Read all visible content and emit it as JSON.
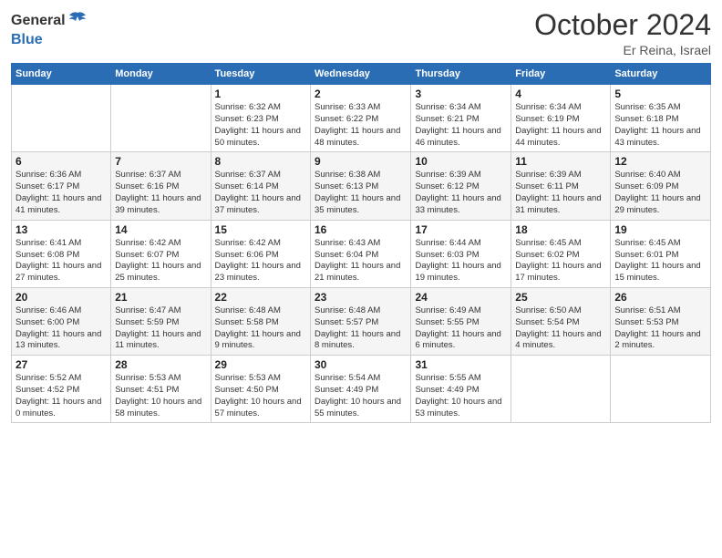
{
  "logo": {
    "general": "General",
    "blue": "Blue"
  },
  "header": {
    "month": "October 2024",
    "location": "Er Reina, Israel"
  },
  "weekdays": [
    "Sunday",
    "Monday",
    "Tuesday",
    "Wednesday",
    "Thursday",
    "Friday",
    "Saturday"
  ],
  "weeks": [
    [
      {
        "day": "",
        "sunrise": "",
        "sunset": "",
        "daylight": ""
      },
      {
        "day": "",
        "sunrise": "",
        "sunset": "",
        "daylight": ""
      },
      {
        "day": "1",
        "sunrise": "Sunrise: 6:32 AM",
        "sunset": "Sunset: 6:23 PM",
        "daylight": "Daylight: 11 hours and 50 minutes."
      },
      {
        "day": "2",
        "sunrise": "Sunrise: 6:33 AM",
        "sunset": "Sunset: 6:22 PM",
        "daylight": "Daylight: 11 hours and 48 minutes."
      },
      {
        "day": "3",
        "sunrise": "Sunrise: 6:34 AM",
        "sunset": "Sunset: 6:21 PM",
        "daylight": "Daylight: 11 hours and 46 minutes."
      },
      {
        "day": "4",
        "sunrise": "Sunrise: 6:34 AM",
        "sunset": "Sunset: 6:19 PM",
        "daylight": "Daylight: 11 hours and 44 minutes."
      },
      {
        "day": "5",
        "sunrise": "Sunrise: 6:35 AM",
        "sunset": "Sunset: 6:18 PM",
        "daylight": "Daylight: 11 hours and 43 minutes."
      }
    ],
    [
      {
        "day": "6",
        "sunrise": "Sunrise: 6:36 AM",
        "sunset": "Sunset: 6:17 PM",
        "daylight": "Daylight: 11 hours and 41 minutes."
      },
      {
        "day": "7",
        "sunrise": "Sunrise: 6:37 AM",
        "sunset": "Sunset: 6:16 PM",
        "daylight": "Daylight: 11 hours and 39 minutes."
      },
      {
        "day": "8",
        "sunrise": "Sunrise: 6:37 AM",
        "sunset": "Sunset: 6:14 PM",
        "daylight": "Daylight: 11 hours and 37 minutes."
      },
      {
        "day": "9",
        "sunrise": "Sunrise: 6:38 AM",
        "sunset": "Sunset: 6:13 PM",
        "daylight": "Daylight: 11 hours and 35 minutes."
      },
      {
        "day": "10",
        "sunrise": "Sunrise: 6:39 AM",
        "sunset": "Sunset: 6:12 PM",
        "daylight": "Daylight: 11 hours and 33 minutes."
      },
      {
        "day": "11",
        "sunrise": "Sunrise: 6:39 AM",
        "sunset": "Sunset: 6:11 PM",
        "daylight": "Daylight: 11 hours and 31 minutes."
      },
      {
        "day": "12",
        "sunrise": "Sunrise: 6:40 AM",
        "sunset": "Sunset: 6:09 PM",
        "daylight": "Daylight: 11 hours and 29 minutes."
      }
    ],
    [
      {
        "day": "13",
        "sunrise": "Sunrise: 6:41 AM",
        "sunset": "Sunset: 6:08 PM",
        "daylight": "Daylight: 11 hours and 27 minutes."
      },
      {
        "day": "14",
        "sunrise": "Sunrise: 6:42 AM",
        "sunset": "Sunset: 6:07 PM",
        "daylight": "Daylight: 11 hours and 25 minutes."
      },
      {
        "day": "15",
        "sunrise": "Sunrise: 6:42 AM",
        "sunset": "Sunset: 6:06 PM",
        "daylight": "Daylight: 11 hours and 23 minutes."
      },
      {
        "day": "16",
        "sunrise": "Sunrise: 6:43 AM",
        "sunset": "Sunset: 6:04 PM",
        "daylight": "Daylight: 11 hours and 21 minutes."
      },
      {
        "day": "17",
        "sunrise": "Sunrise: 6:44 AM",
        "sunset": "Sunset: 6:03 PM",
        "daylight": "Daylight: 11 hours and 19 minutes."
      },
      {
        "day": "18",
        "sunrise": "Sunrise: 6:45 AM",
        "sunset": "Sunset: 6:02 PM",
        "daylight": "Daylight: 11 hours and 17 minutes."
      },
      {
        "day": "19",
        "sunrise": "Sunrise: 6:45 AM",
        "sunset": "Sunset: 6:01 PM",
        "daylight": "Daylight: 11 hours and 15 minutes."
      }
    ],
    [
      {
        "day": "20",
        "sunrise": "Sunrise: 6:46 AM",
        "sunset": "Sunset: 6:00 PM",
        "daylight": "Daylight: 11 hours and 13 minutes."
      },
      {
        "day": "21",
        "sunrise": "Sunrise: 6:47 AM",
        "sunset": "Sunset: 5:59 PM",
        "daylight": "Daylight: 11 hours and 11 minutes."
      },
      {
        "day": "22",
        "sunrise": "Sunrise: 6:48 AM",
        "sunset": "Sunset: 5:58 PM",
        "daylight": "Daylight: 11 hours and 9 minutes."
      },
      {
        "day": "23",
        "sunrise": "Sunrise: 6:48 AM",
        "sunset": "Sunset: 5:57 PM",
        "daylight": "Daylight: 11 hours and 8 minutes."
      },
      {
        "day": "24",
        "sunrise": "Sunrise: 6:49 AM",
        "sunset": "Sunset: 5:55 PM",
        "daylight": "Daylight: 11 hours and 6 minutes."
      },
      {
        "day": "25",
        "sunrise": "Sunrise: 6:50 AM",
        "sunset": "Sunset: 5:54 PM",
        "daylight": "Daylight: 11 hours and 4 minutes."
      },
      {
        "day": "26",
        "sunrise": "Sunrise: 6:51 AM",
        "sunset": "Sunset: 5:53 PM",
        "daylight": "Daylight: 11 hours and 2 minutes."
      }
    ],
    [
      {
        "day": "27",
        "sunrise": "Sunrise: 5:52 AM",
        "sunset": "Sunset: 4:52 PM",
        "daylight": "Daylight: 11 hours and 0 minutes."
      },
      {
        "day": "28",
        "sunrise": "Sunrise: 5:53 AM",
        "sunset": "Sunset: 4:51 PM",
        "daylight": "Daylight: 10 hours and 58 minutes."
      },
      {
        "day": "29",
        "sunrise": "Sunrise: 5:53 AM",
        "sunset": "Sunset: 4:50 PM",
        "daylight": "Daylight: 10 hours and 57 minutes."
      },
      {
        "day": "30",
        "sunrise": "Sunrise: 5:54 AM",
        "sunset": "Sunset: 4:49 PM",
        "daylight": "Daylight: 10 hours and 55 minutes."
      },
      {
        "day": "31",
        "sunrise": "Sunrise: 5:55 AM",
        "sunset": "Sunset: 4:49 PM",
        "daylight": "Daylight: 10 hours and 53 minutes."
      },
      {
        "day": "",
        "sunrise": "",
        "sunset": "",
        "daylight": ""
      },
      {
        "day": "",
        "sunrise": "",
        "sunset": "",
        "daylight": ""
      }
    ]
  ]
}
